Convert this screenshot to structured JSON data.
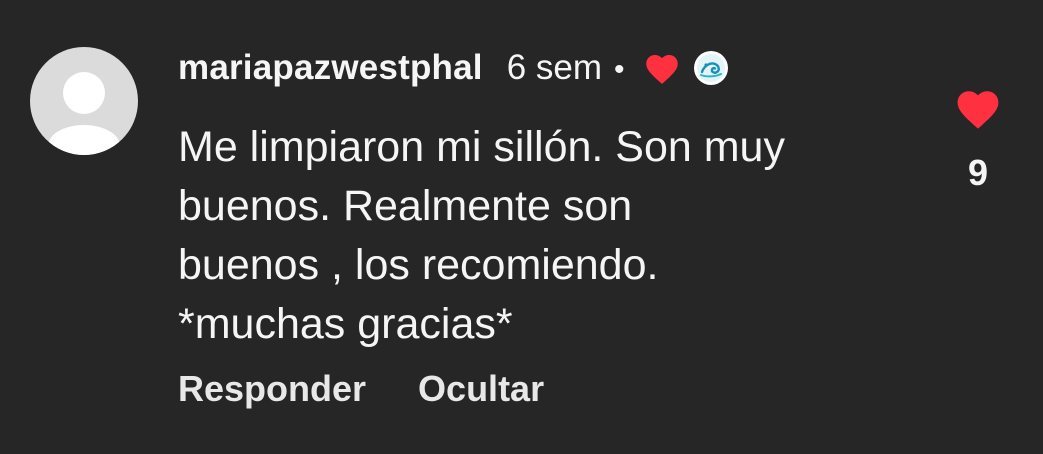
{
  "comment": {
    "username": "mariapazwestphal",
    "time": "6 sem",
    "separator": "•",
    "text_lines": [
      "Me limpiaron mi sillón. Son muy",
      "buenos. Realmente son",
      "buenos , los recomiendo.",
      "*muchas gracias*"
    ],
    "actions": {
      "reply_label": "Responder",
      "hide_label": "Ocultar"
    },
    "like_count": "9",
    "author_liked": true
  },
  "icons": {
    "avatar": "default-avatar-icon",
    "author_like": "heart-icon",
    "author_avatar": "creator-avatar-icon",
    "like": "heart-icon"
  },
  "colors": {
    "background": "#262626",
    "heart": "#ff3040",
    "text": "#f5f5f5",
    "avatar": "#dbdbdb"
  }
}
